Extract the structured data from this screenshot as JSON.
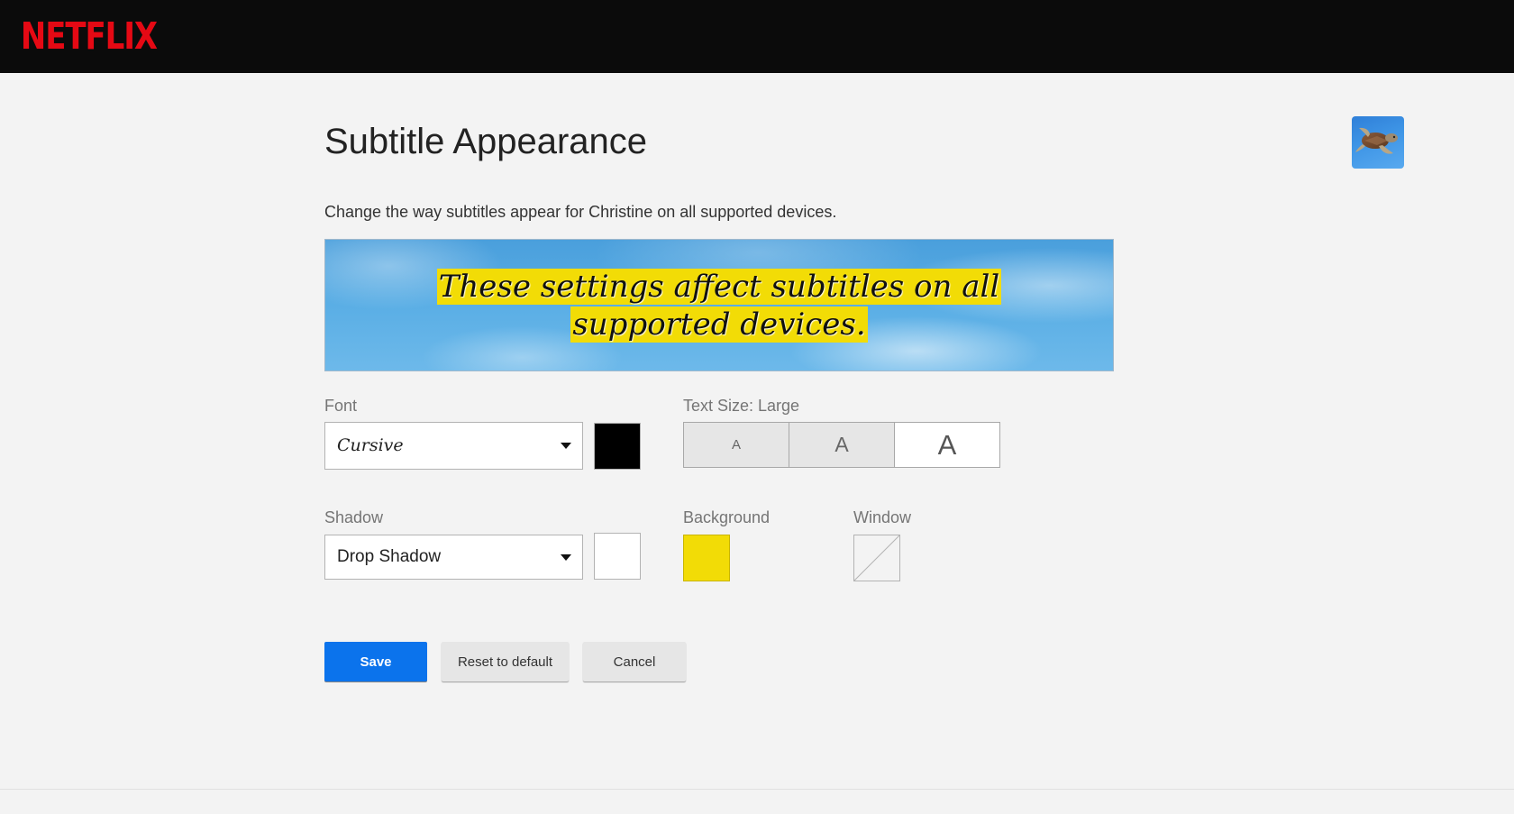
{
  "header": {
    "logo": "NETFLIX"
  },
  "profile": {
    "avatar_icon": "sea-turtle-avatar"
  },
  "page": {
    "title": "Subtitle Appearance",
    "description": "Change the way subtitles appear for Christine on all supported devices."
  },
  "preview": {
    "line1": "These settings affect subtitles on all",
    "line2": "supported devices."
  },
  "font": {
    "label": "Font",
    "value": "Cursive",
    "color": "#000000"
  },
  "text_size": {
    "label": "Text Size: Large",
    "options": [
      "A",
      "A",
      "A"
    ],
    "selected": "large"
  },
  "shadow": {
    "label": "Shadow",
    "value": "Drop Shadow",
    "color": "#ffffff"
  },
  "background": {
    "label": "Background",
    "color": "#f2dc06"
  },
  "window": {
    "label": "Window",
    "value": "none"
  },
  "actions": {
    "save": "Save",
    "reset": "Reset to default",
    "cancel": "Cancel"
  },
  "colors": {
    "brand": "#e50914",
    "primary_button": "#0b73ec",
    "subtitle_background": "#f2dc06"
  }
}
